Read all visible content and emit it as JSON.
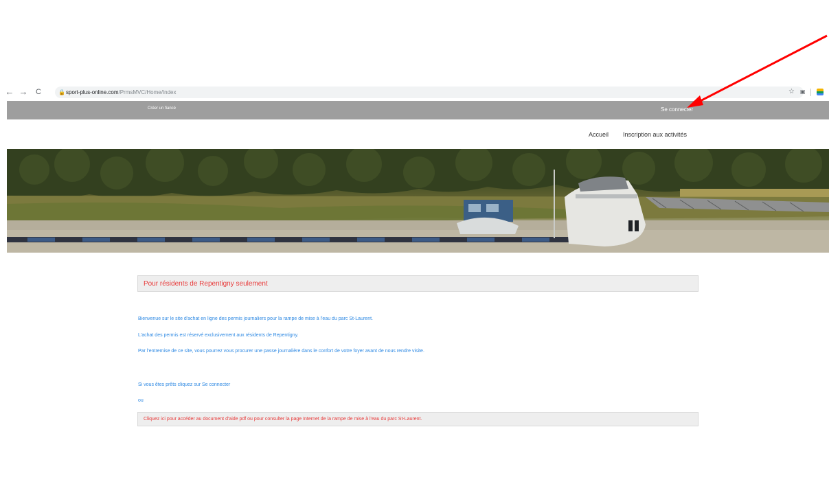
{
  "browser": {
    "url_domain": "sport-plus-online.com",
    "url_path": "/PrmsMVC/Home/Index",
    "back_icon": "←",
    "forward_icon": "→",
    "reload_icon": "C",
    "lock_icon": "🔒",
    "star_icon": "☆"
  },
  "topbar": {
    "create_account": "Créer un fiancé",
    "login": "Se connecter"
  },
  "nav": {
    "home": "Accueil",
    "activities": "Inscription aux activités"
  },
  "notice": {
    "title": "Pour résidents de Repentigny seulement"
  },
  "intro": {
    "line1": "Bienvenue sur le site d'achat en ligne des permis journaliers pour la rampe de mise à l'eau du parc St-Laurent.",
    "line2": "L'achat des permis est réservé exclusivement aux résidents de Repentigny.",
    "line3": "Par l'entremise de ce site, vous pourrez vous procurer une passe journalière dans le confort de votre foyer avant de nous rendre visite.",
    "ready": "Si vous êtes prêts cliquez sur Se connecter",
    "or": "ou"
  },
  "help": {
    "text": "Cliquez ici pour accéder au document d'aide pdf ou pour consulter la page Internet de la rampe de mise à l'eau du parc St-Laurent."
  },
  "colors": {
    "topbar": "#9e9e9e",
    "notice_red": "#e83a3a",
    "link_blue": "#2e89e3",
    "annotation_arrow": "#ff0000"
  }
}
